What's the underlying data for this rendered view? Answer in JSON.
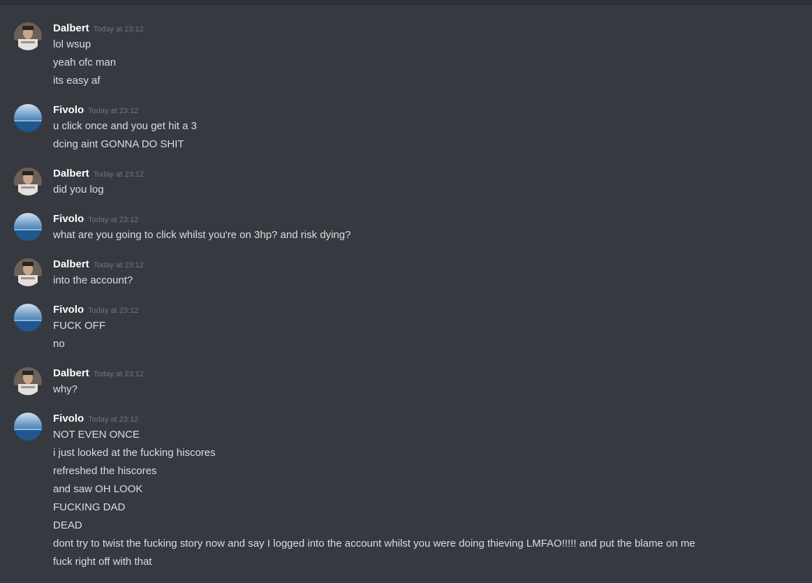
{
  "messages": [
    {
      "author": "Dalbert",
      "avatar": "dalbert-avatar-photo",
      "timestamp": "Today at 23:12",
      "lines": [
        "lol wsup",
        "yeah ofc man",
        "its easy af"
      ]
    },
    {
      "author": "Fivolo",
      "avatar": "fivolo-avatar-ocean",
      "timestamp": "Today at 23:12",
      "lines": [
        "u click once and you get hit a 3",
        "dcing aint GONNA DO SHIT"
      ]
    },
    {
      "author": "Dalbert",
      "avatar": "dalbert-avatar-photo",
      "timestamp": "Today at 23:12",
      "lines": [
        "did you log"
      ]
    },
    {
      "author": "Fivolo",
      "avatar": "fivolo-avatar-ocean",
      "timestamp": "Today at 23:12",
      "lines": [
        "what are you going to click whilst you're on 3hp? and risk dying?"
      ]
    },
    {
      "author": "Dalbert",
      "avatar": "dalbert-avatar-photo",
      "timestamp": "Today at 23:12",
      "lines": [
        "into the account?"
      ]
    },
    {
      "author": "Fivolo",
      "avatar": "fivolo-avatar-ocean",
      "timestamp": "Today at 23:12",
      "lines": [
        "FUCK OFF",
        "no"
      ]
    },
    {
      "author": "Dalbert",
      "avatar": "dalbert-avatar-photo",
      "timestamp": "Today at 23:12",
      "lines": [
        "why?"
      ]
    },
    {
      "author": "Fivolo",
      "avatar": "fivolo-avatar-ocean",
      "timestamp": "Today at 23:12",
      "lines": [
        "NOT EVEN ONCE",
        "i just looked at the fucking hiscores",
        "refreshed the hiscores",
        "and saw OH LOOK",
        "FUCKING DAD",
        "DEAD",
        "dont try to twist the fucking story now and say I logged into the account whilst you were doing thieving LMFAO!!!!! and put the blame on me",
        "fuck right off with that"
      ]
    }
  ],
  "colors": {
    "background": "#36393f",
    "username": "#ffffff",
    "message_text": "#dcddde",
    "timestamp": "#72767d"
  }
}
